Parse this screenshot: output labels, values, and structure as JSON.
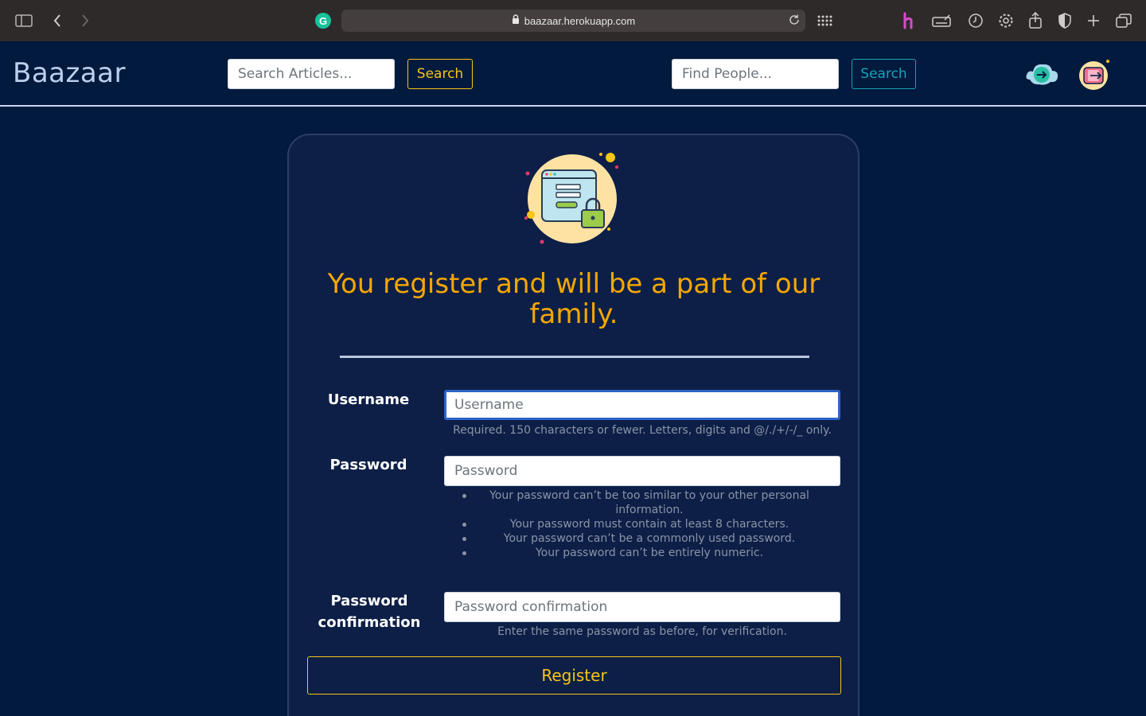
{
  "browser": {
    "url": "baazaar.herokuapp.com",
    "grammarly_letter": "G"
  },
  "navbar": {
    "brand": "Baazaar",
    "article_search_placeholder": "Search Articles...",
    "article_search_button": "Search",
    "people_search_placeholder": "Find People...",
    "people_search_button": "Search"
  },
  "form": {
    "headline": "You register and will be a part of our family.",
    "username": {
      "label": "Username",
      "placeholder": "Username",
      "help": "Required. 150 characters or fewer. Letters, digits and @/./+/-/_ only."
    },
    "password": {
      "label": "Password",
      "placeholder": "Password",
      "rules": [
        "Your password can’t be too similar to your other personal information.",
        "Your password must contain at least 8 characters.",
        "Your password can’t be a commonly used password.",
        "Your password can’t be entirely numeric."
      ]
    },
    "password_confirmation": {
      "label": "Password confirmation",
      "placeholder": "Password confirmation",
      "help": "Enter the same password as before, for verification."
    },
    "submit_label": "Register"
  },
  "colors": {
    "page_bg": "#021a3d",
    "card_bg": "#0d1f47",
    "accent_yellow": "#f5c518",
    "headline_orange": "#f5a700",
    "accent_teal": "#17a2b8"
  }
}
